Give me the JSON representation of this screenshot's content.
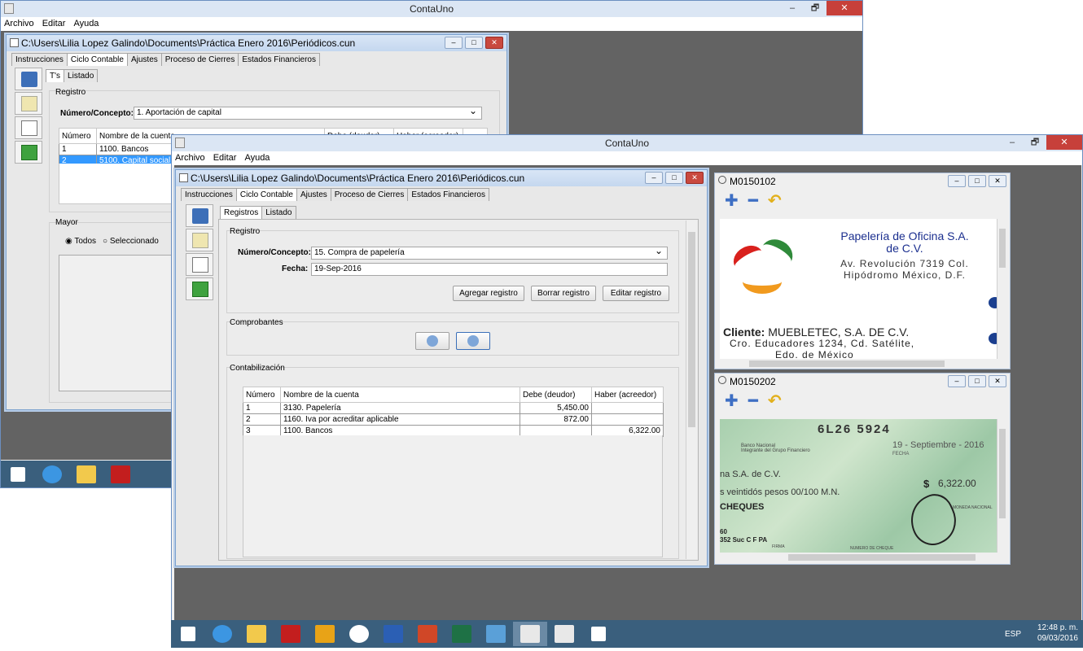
{
  "app_title": "ContaUno",
  "menu": [
    "Archivo",
    "Editar",
    "Ayuda"
  ],
  "window_controls": {
    "minimize": "–",
    "restore": "🗗",
    "close": "✕"
  },
  "back_doc": {
    "title": "C:\\Users\\Lilia Lopez Galindo\\Documents\\Práctica Enero 2016\\Periódicos.cun",
    "tabs": [
      "Instrucciones",
      "Ciclo Contable",
      "Ajustes",
      "Proceso de Cierres",
      "Estados Financieros"
    ],
    "subtabs": [
      "T's",
      "Listado"
    ],
    "registro_label": "Registro",
    "concepto_label": "Número/Concepto:",
    "concepto_value": "1. Aportación de capital",
    "table_headers": [
      "Número",
      "Nombre de la cuenta",
      "Debe (deudor)",
      "Haber (acreedor)"
    ],
    "rows": [
      [
        "1",
        "1100. Bancos"
      ],
      [
        "2",
        "5100. Capital social"
      ]
    ],
    "mayor_label": "Mayor",
    "radio_todos": "Todos",
    "radio_seleccionado": "Seleccionado"
  },
  "front_doc": {
    "title": "C:\\Users\\Lilia Lopez Galindo\\Documents\\Práctica Enero 2016\\Periódicos.cun",
    "tabs": [
      "Instrucciones",
      "Ciclo Contable",
      "Ajustes",
      "Proceso de Cierres",
      "Estados Financieros"
    ],
    "subtabs": [
      "Registros",
      "Listado"
    ],
    "registro_label": "Registro",
    "concepto_label": "Número/Concepto:",
    "concepto_value": "15. Compra de papelería",
    "fecha_label": "Fecha:",
    "fecha_value": "19-Sep-2016",
    "buttons": [
      "Agregar registro",
      "Borrar registro",
      "Editar registro"
    ],
    "comprobantes_label": "Comprobantes",
    "contabilizacion_label": "Contabilización",
    "table_headers": [
      "Número",
      "Nombre de la cuenta",
      "Debe (deudor)",
      "Haber (acreedor)"
    ],
    "rows": [
      [
        "1",
        "3130. Papelería",
        "5,450.00",
        ""
      ],
      [
        "2",
        "1160. Iva por acreditar aplicable",
        "872.00",
        ""
      ],
      [
        "3",
        "1100. Bancos",
        "",
        "6,322.00"
      ]
    ]
  },
  "viewer1": {
    "title": "M0150102",
    "company_line1": "Papelería de Oficina S.A.",
    "company_line2": "de C.V.",
    "address1": "Av. Revolución 7319 Col.",
    "address2": "Hipódromo México, D.F.",
    "client_label": "Cliente:",
    "client_name": "MUEBLETEC, S.A. DE C.V.",
    "client_addr1": "Cro. Educadores 1234, Cd. Satélite,",
    "client_addr2": "Edo. de México"
  },
  "viewer2": {
    "title": "M0150202",
    "check_number": "6L26 5924",
    "bank": "Banco Nacional",
    "bank_sub": "Integrante del Grupo Financiero",
    "date": "19 - Septiembre - 2016",
    "date_label": "FECHA",
    "payee": "na S.A. de C.V.",
    "amount_words": "s veintidós pesos 00/100 M.N.",
    "currency": "$",
    "amount": "6,322.00",
    "cheques": "CHEQUES",
    "moneda": "MONEDA NACIONAL",
    "acct1": "60",
    "acct2": "352 Suc C F PA",
    "firma": "FIRMA",
    "numero": "NUMERO DE CHEQUE"
  },
  "tray": {
    "lang": "ESP",
    "time": "12:48 p. m.",
    "date": "09/03/2016"
  },
  "colors": {
    "selection": "#3399ff",
    "desktop": "#636363",
    "taskbar": "#3a5f7d"
  }
}
